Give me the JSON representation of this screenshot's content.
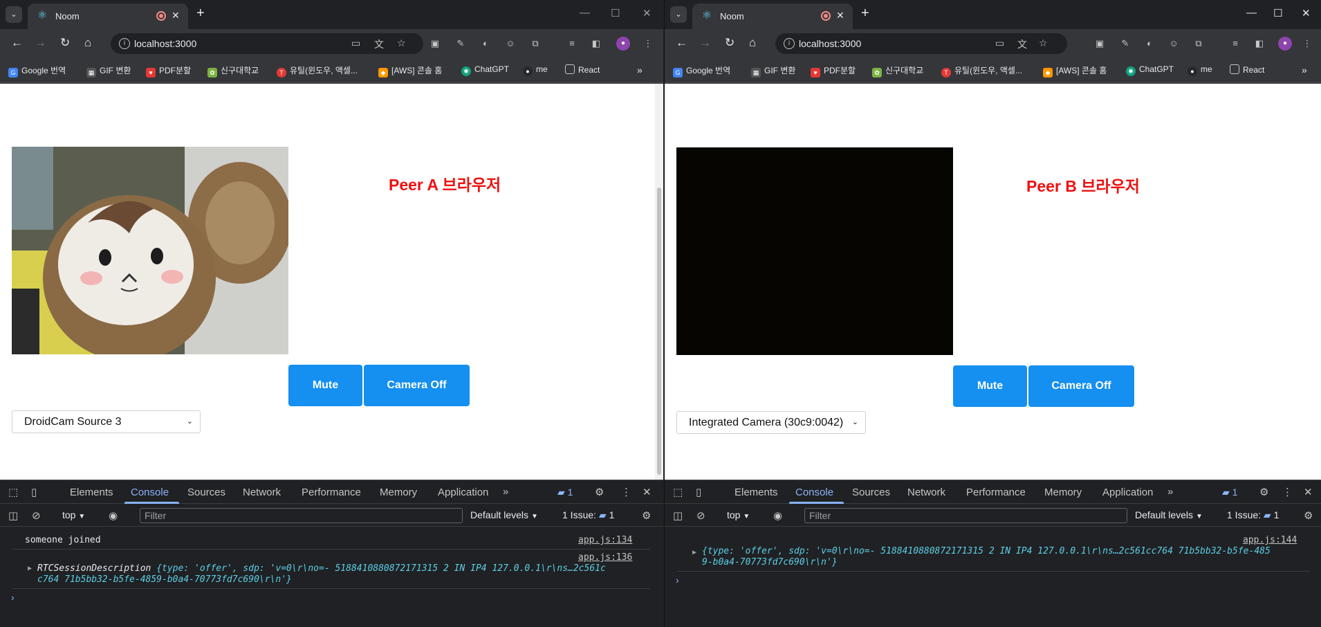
{
  "colors": {
    "peer_title": "#ee1111",
    "button_bg": "#158ff0",
    "devtools_accent": "#8ab4f8",
    "console_string": "#5ccfe6"
  },
  "window_controls": {
    "minimize": "—",
    "maximize": "☐",
    "close": "✕"
  },
  "windows": [
    {
      "tab": {
        "title": "Noom"
      },
      "url": "localhost:3000",
      "bookmarks": [
        "Google 번역",
        "GIF 변환",
        "PDF분할",
        "신구대학교",
        "유틸(윈도우, 액셀...",
        "[AWS] 콘솔 홈",
        "ChatGPT",
        "me",
        "React"
      ],
      "page": {
        "heading": "Peer A 브라우저",
        "mute_label": "Mute",
        "camera_label": "Camera Off",
        "camera_select": "DroidCam Source 3"
      },
      "devtools": {
        "tabs": [
          "Elements",
          "Console",
          "Sources",
          "Network",
          "Performance",
          "Memory",
          "Application"
        ],
        "active_tab": "Console",
        "message_count": "1",
        "context": "top",
        "filter_placeholder": "Filter",
        "levels": "Default levels",
        "issues_label": "1 Issue:",
        "issues_count": "1",
        "logs": [
          {
            "text": "someone joined",
            "source": "app.js:134"
          },
          {
            "prefix": "RTCSessionDescription",
            "line1": "{type: 'offer', sdp: 'v=0\\r\\no=- 5188410880872171315 2 IN IP4 127.0.0.1\\r\\ns…2c561c",
            "line2": "c764 71b5bb32-b5fe-4859-b0a4-70773fd7c690\\r\\n'}",
            "source": "app.js:136"
          }
        ]
      }
    },
    {
      "tab": {
        "title": "Noom"
      },
      "url": "localhost:3000",
      "bookmarks": [
        "Google 번역",
        "GIF 변환",
        "PDF분할",
        "신구대학교",
        "유틸(윈도우, 액셀...",
        "[AWS] 콘솔 홈",
        "ChatGPT",
        "me",
        "React"
      ],
      "page": {
        "heading": "Peer B 브라우저",
        "mute_label": "Mute",
        "camera_label": "Camera Off",
        "camera_select": "Integrated Camera (30c9:0042)"
      },
      "devtools": {
        "tabs": [
          "Elements",
          "Console",
          "Sources",
          "Network",
          "Performance",
          "Memory",
          "Application"
        ],
        "active_tab": "Console",
        "message_count": "1",
        "context": "top",
        "filter_placeholder": "Filter",
        "levels": "Default levels",
        "issues_label": "1 Issue:",
        "issues_count": "1",
        "logs": [
          {
            "line1": "{type: 'offer', sdp: 'v=0\\r\\no=- 5188410880872171315 2 IN IP4 127.0.0.1\\r\\ns…2c561cc764 71b5bb32-b5fe-485",
            "line2": "9-b0a4-70773fd7c690\\r\\n'}",
            "source": "app.js:144"
          }
        ]
      }
    }
  ]
}
